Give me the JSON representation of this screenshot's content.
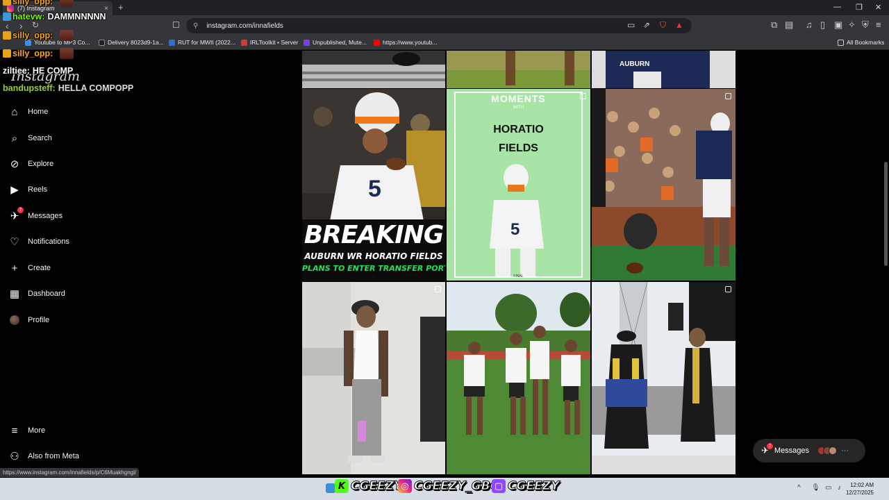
{
  "browser": {
    "tab_title": "(7) Instagram",
    "tab_close": "×",
    "new_tab": "+",
    "url": "instagram.com/innafields",
    "bookmarks": [
      {
        "label": "Youtube to MP3 Co...",
        "color": "#3b8ee8"
      },
      {
        "label": "Delivery 8023d9-1a...",
        "color": "#222"
      },
      {
        "label": "RUT for MWII (2022...",
        "color": "#2b6fd6"
      },
      {
        "label": "IRLToolkit • Server",
        "color": "#d33"
      },
      {
        "label": "Unpublished, Mute...",
        "color": "#7b3fe4"
      },
      {
        "label": "https://www.youtub...",
        "color": "#f00"
      }
    ],
    "all_bookmarks": "All Bookmarks"
  },
  "sidebar": {
    "logo": "Instagram",
    "items": [
      {
        "label": "Home",
        "icon": "home-icon"
      },
      {
        "label": "Search",
        "icon": "search-icon"
      },
      {
        "label": "Explore",
        "icon": "compass-icon"
      },
      {
        "label": "Reels",
        "icon": "reels-icon"
      },
      {
        "label": "Messages",
        "icon": "messenger-icon",
        "badge": "7"
      },
      {
        "label": "Notifications",
        "icon": "heart-icon"
      },
      {
        "label": "Create",
        "icon": "plus-icon"
      },
      {
        "label": "Dashboard",
        "icon": "dashboard-icon"
      },
      {
        "label": "Profile",
        "icon": "avatar"
      }
    ],
    "more": "More",
    "also_from_meta": "Also from Meta"
  },
  "posts": [
    {
      "id": "p1",
      "text": ""
    },
    {
      "id": "p2",
      "text": ""
    },
    {
      "id": "p3",
      "text": ""
    },
    {
      "id": "p4",
      "headline": "BREAKING",
      "subhead": "AUBURN WR HORATIO FIELDS",
      "sub2": "PLANS TO ENTER TRANSFER PORTAL"
    },
    {
      "id": "p5",
      "moments": "MOMENTS",
      "with": "WITH",
      "name1": "HORATIO",
      "name2": "FIELDS",
      "footer": "FINAL"
    },
    {
      "id": "p6",
      "text": ""
    },
    {
      "id": "p7",
      "text": ""
    },
    {
      "id": "p8",
      "text": ""
    },
    {
      "id": "p9",
      "text": ""
    }
  ],
  "messages_pill": {
    "label": "Messages",
    "badge": "7"
  },
  "status_url": "https://www.instagram.com/innafields/p/C6Muakhgngl/",
  "taskbar": {
    "time": "12:02 AM",
    "date": "12/27/2025"
  },
  "overlay": {
    "kick": "CGEEZY",
    "instagram": "CGEEZY_GBC",
    "twitch": "CGEEZY"
  },
  "chat": [
    {
      "user": "silly_opp:",
      "msg": "",
      "color": "#f5a623"
    },
    {
      "user": "hatevw:",
      "msg": "DAMMNNNNN",
      "color": "#7CFC00"
    },
    {
      "user": "silly_opp:",
      "msg": "",
      "color": "#f5a623"
    },
    {
      "user": "silly_opp:",
      "msg": "",
      "color": "#f5a623"
    },
    {
      "user": "ziltiee:",
      "msg": "HE COMP",
      "color": "#fff"
    },
    {
      "user": "bandupsteff:",
      "msg": "HELLA COMPOPP",
      "color": "#9acd32"
    }
  ]
}
